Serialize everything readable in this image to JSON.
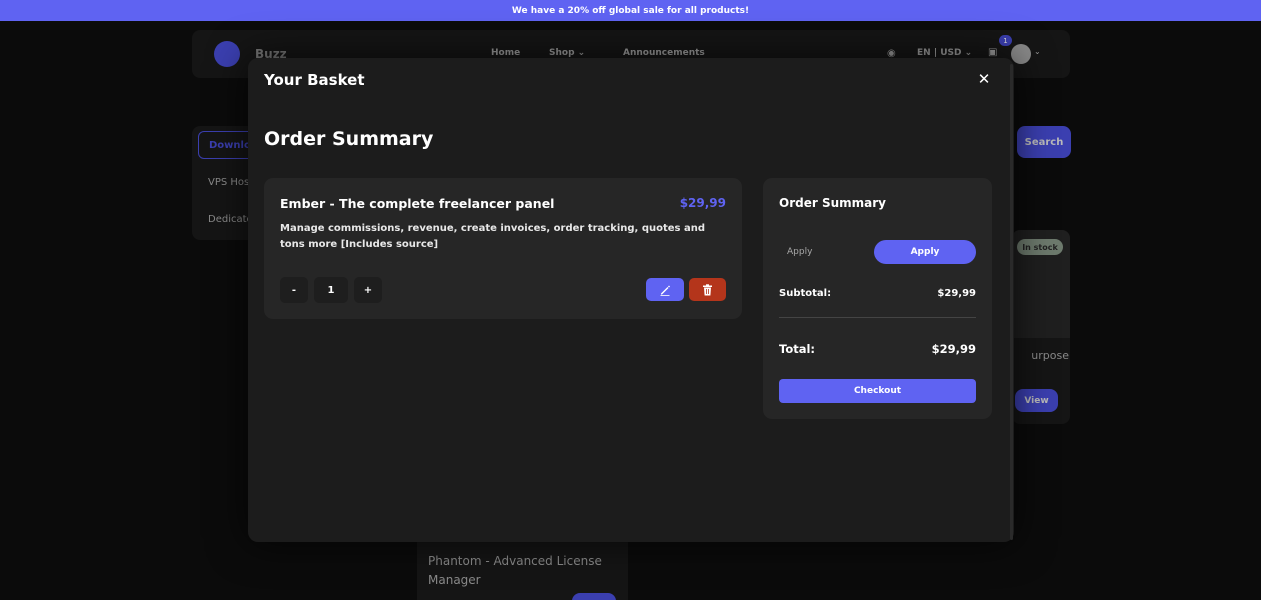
{
  "promo": {
    "text": "We have a 20% off global sale for all products!"
  },
  "background": {
    "brand": "Buzz",
    "nav": {
      "home": "Home",
      "shop": "Shop",
      "announcements": "Announcements"
    },
    "locale": "EN | USD",
    "cart_count": "1",
    "sidebar": {
      "download": "Downloads",
      "vps": "VPS Hosting",
      "dedicated": "Dedicated"
    },
    "search_button": "Search",
    "product_card": {
      "stock": "In stock",
      "title": "urpose",
      "view": "View"
    },
    "bottom_card": {
      "title": "Phantom - Advanced License Manager"
    }
  },
  "modal": {
    "title": "Your Basket",
    "section_title": "Order Summary",
    "item": {
      "name": "Ember - The complete freelancer panel",
      "price": "$29,99",
      "description": "Manage commissions, revenue, create invoices, order tracking, quotes and tons more [Includes source]",
      "quantity": "1",
      "minus": "-",
      "plus": "+"
    },
    "summary": {
      "title": "Order Summary",
      "coupon_placeholder": "Apply",
      "apply_label": "Apply",
      "subtotal_label": "Subtotal:",
      "subtotal_value": "$29,99",
      "total_label": "Total:",
      "total_value": "$29,99",
      "checkout_label": "Checkout"
    }
  },
  "colors": {
    "accent": "#5f63f2",
    "danger": "#b4351b",
    "panel": "#262626",
    "modal": "#1c1c1c"
  }
}
